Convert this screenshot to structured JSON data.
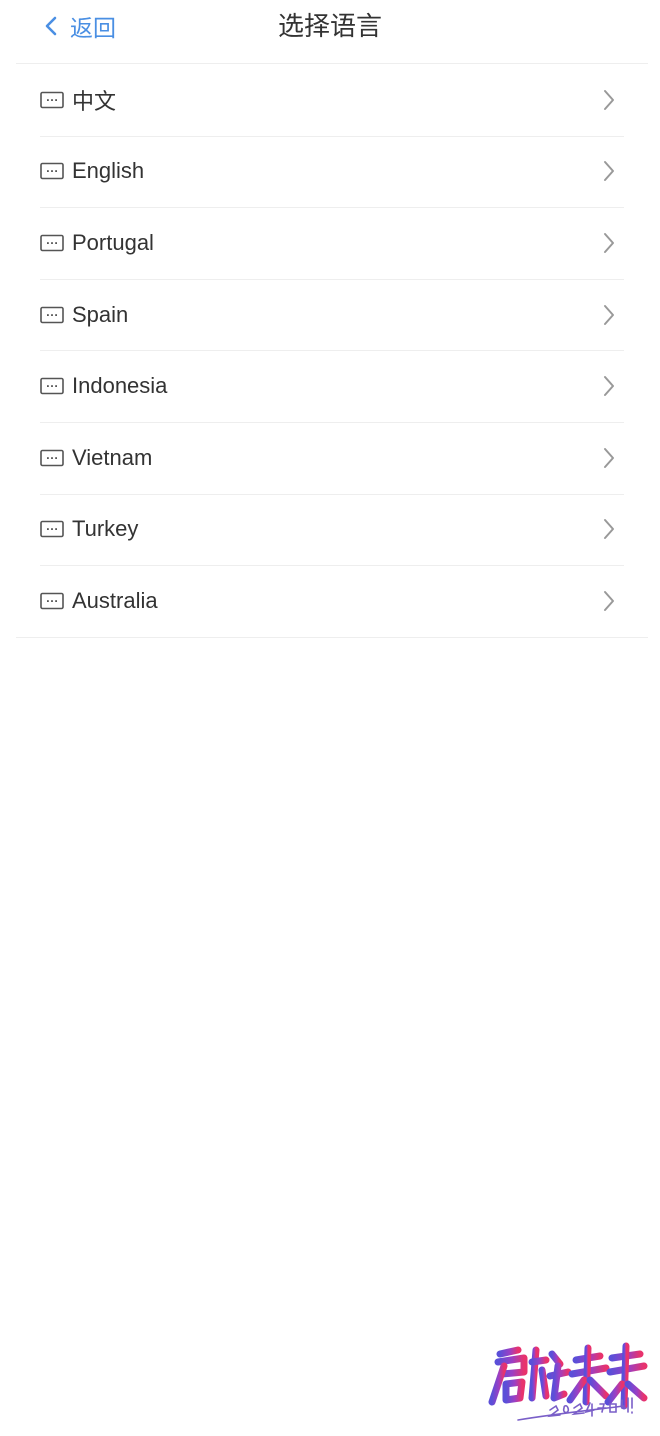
{
  "header": {
    "back_label": "返回",
    "title": "选择语言"
  },
  "languages": [
    {
      "label": "中文"
    },
    {
      "label": "English"
    },
    {
      "label": "Portugal"
    },
    {
      "label": "Spain"
    },
    {
      "label": "Indonesia"
    },
    {
      "label": "Vietnam"
    },
    {
      "label": "Turkey"
    },
    {
      "label": "Australia"
    }
  ],
  "icons": {
    "back": "chevron-left-icon",
    "item": "keyboard-icon",
    "item_arrow": "chevron-right-icon"
  },
  "watermark": {
    "text": "启航未来",
    "subtext": "2024加油!"
  },
  "colors": {
    "accent": "#4a8fe3",
    "text": "#333333",
    "divider": "#eeeeee",
    "chevron": "#999999"
  }
}
